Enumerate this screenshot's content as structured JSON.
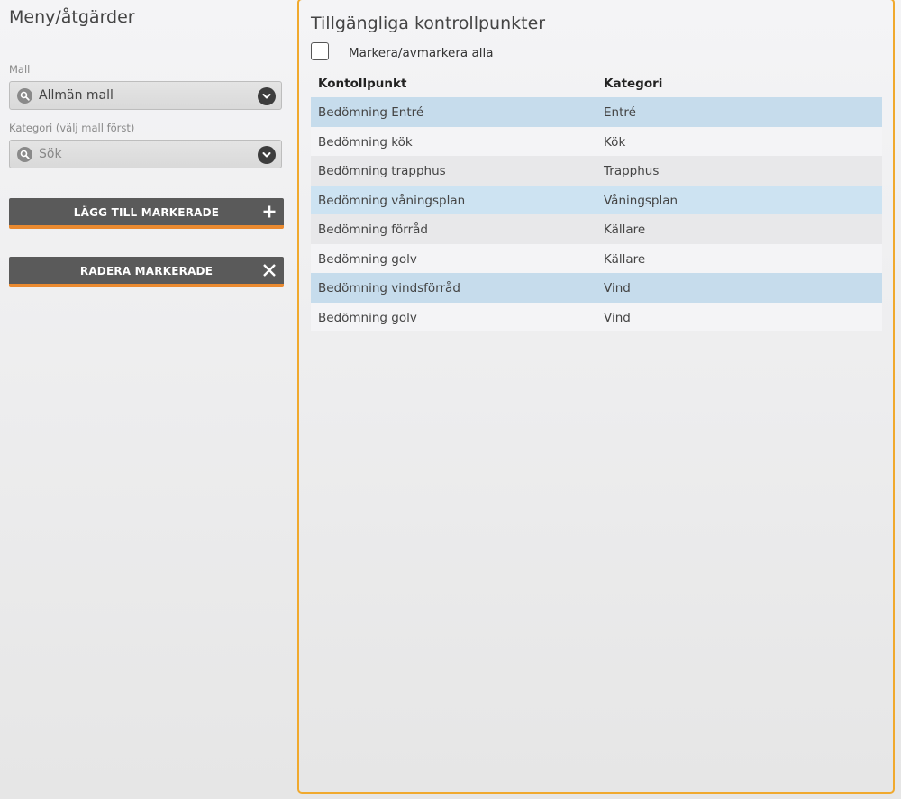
{
  "menu": {
    "title": "Meny/åtgärder",
    "template": {
      "label": "Mall",
      "value": "Allmän mall"
    },
    "category": {
      "label": "Kategori (välj mall först)",
      "placeholder": "Sök"
    },
    "add_button": {
      "label": "LÄGG TILL MARKERADE",
      "icon": "plus-icon"
    },
    "delete_button": {
      "label": "RADERA MARKERADE",
      "icon": "close-icon"
    }
  },
  "panel": {
    "title": "Tillgängliga kontrollpunkter",
    "select_all_label": "Markera/avmarkera alla",
    "select_all_checked": false,
    "columns": [
      "Kontollpunkt",
      "Kategori"
    ],
    "rows": [
      {
        "checkpoint": "Bedömning Entré",
        "category": "Entré",
        "selected": true
      },
      {
        "checkpoint": "Bedömning kök",
        "category": "Kök",
        "selected": false
      },
      {
        "checkpoint": "Bedömning trapphus",
        "category": "Trapphus",
        "selected": false
      },
      {
        "checkpoint": "Bedömning våningsplan",
        "category": "Våningsplan",
        "selected": true
      },
      {
        "checkpoint": "Bedömning förråd",
        "category": "Källare",
        "selected": false
      },
      {
        "checkpoint": "Bedömning golv",
        "category": "Källare",
        "selected": false
      },
      {
        "checkpoint": "Bedömning vindsförråd",
        "category": "Vind",
        "selected": true
      },
      {
        "checkpoint": "Bedömning golv",
        "category": "Vind",
        "selected": false
      }
    ]
  },
  "colors": {
    "accent": "#f0a92e",
    "button_underline": "#ea8a30",
    "button_bg": "#5a5a5a",
    "row_selected": "#c6dcec",
    "row_selected_alt": "#cde3f2",
    "row_odd": "#f4f4f6",
    "row_even": "#e8e8ea"
  }
}
